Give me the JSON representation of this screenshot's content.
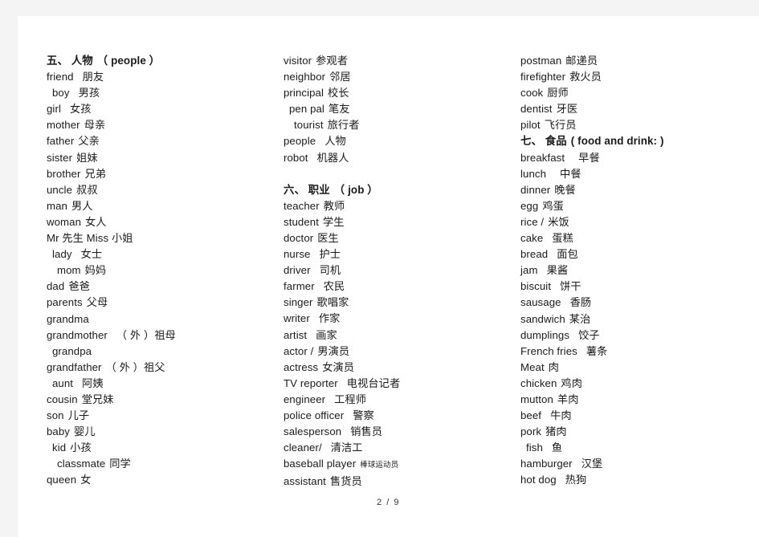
{
  "document": {
    "page_label": "2 / 9",
    "background_color": "#f4f4f4",
    "page_color": "#ffffff",
    "text_color": "#1a1a1a"
  },
  "columns": [
    {
      "id": "column-1",
      "entries": [
        {
          "en": "五、 人物",
          "cn": "（ people ）",
          "heading": true,
          "raw": "五、 人物（people）"
        },
        {
          "en": "friend",
          "cn": "朋友",
          "gap": "wide"
        },
        {
          "en": "boy",
          "cn": "男孩",
          "indent": 1,
          "gap": "wide"
        },
        {
          "en": "girl",
          "cn": "女孩",
          "gap": "wide"
        },
        {
          "en": "mother",
          "cn": "母亲",
          "gap": "normal"
        },
        {
          "en": "father",
          "cn": "父亲",
          "gap": "normal"
        },
        {
          "en": "sister",
          "cn": "姐妹",
          "gap": "normal"
        },
        {
          "en": "brother",
          "cn": "兄弟",
          "gap": "normal"
        },
        {
          "en": "uncle",
          "cn": "叔叔",
          "gap": "normal"
        },
        {
          "en": "man",
          "cn": "男人",
          "gap": "normal"
        },
        {
          "en": "woman",
          "cn": "女人",
          "gap": "normal"
        },
        {
          "en": "Mr 先生   Miss 小姐",
          "cn": "",
          "gap": "none"
        },
        {
          "en": "lady",
          "cn": "女士",
          "indent": 1,
          "gap": "wide"
        },
        {
          "en": "mom",
          "cn": "妈妈",
          "indent": 2,
          "gap": "normal"
        },
        {
          "en": "dad",
          "cn": "爸爸",
          "gap": "normal"
        },
        {
          "en": "parents",
          "cn": "父母",
          "gap": "normal"
        },
        {
          "en": "grandma",
          "cn": "",
          "gap": "none"
        },
        {
          "en": "grandmother",
          "cn": "（ 外 ）祖母",
          "gap": "wide"
        },
        {
          "en": "grandpa",
          "cn": "",
          "indent": 1,
          "gap": "none"
        },
        {
          "en": "grandfather",
          "cn": "（ 外 ）祖父",
          "gap": "normal"
        },
        {
          "en": "aunt",
          "cn": "阿姨",
          "indent": 1,
          "gap": "wide"
        },
        {
          "en": "cousin",
          "cn": "堂兄妹",
          "gap": "normal"
        },
        {
          "en": "son",
          "cn": "儿子",
          "gap": "normal"
        },
        {
          "en": "baby",
          "cn": "婴儿",
          "gap": "normal"
        },
        {
          "en": "kid",
          "cn": "小孩",
          "indent": 1,
          "gap": "normal"
        },
        {
          "en": "classmate",
          "cn": "同学",
          "indent": 2,
          "gap": "normal"
        },
        {
          "en": "queen",
          "cn": "女",
          "gap": "normal"
        }
      ]
    },
    {
      "id": "column-2",
      "entries": [
        {
          "en": "visitor",
          "cn": "参观者",
          "gap": "normal"
        },
        {
          "en": "neighbor",
          "cn": "邻居",
          "gap": "normal"
        },
        {
          "en": "principal",
          "cn": "校长",
          "gap": "normal"
        },
        {
          "en": "pen pal",
          "cn": "笔友",
          "indent": 1,
          "gap": "normal"
        },
        {
          "en": "tourist",
          "cn": "旅行者",
          "indent": 2,
          "gap": "normal"
        },
        {
          "en": "people",
          "cn": "人物",
          "gap": "wide"
        },
        {
          "en": "robot",
          "cn": "机器人",
          "gap": "wide"
        },
        {
          "en": "六、 职业",
          "cn": "（ job ）",
          "heading": true,
          "spacer": true,
          "raw": "六、 职业（job）"
        },
        {
          "en": "teacher",
          "cn": "教师",
          "gap": "normal"
        },
        {
          "en": "student",
          "cn": "学生",
          "gap": "normal"
        },
        {
          "en": "doctor",
          "cn": "医生",
          "gap": "normal"
        },
        {
          "en": "nurse",
          "cn": "护士",
          "gap": "wide"
        },
        {
          "en": "driver",
          "cn": "司机",
          "gap": "wide"
        },
        {
          "en": "farmer",
          "cn": "农民",
          "gap": "wide"
        },
        {
          "en": "singer",
          "cn": "歌唱家",
          "gap": "normal"
        },
        {
          "en": "writer",
          "cn": "作家",
          "gap": "wide"
        },
        {
          "en": "artist",
          "cn": "画家",
          "gap": "wide"
        },
        {
          "en": "actor /",
          "cn": "男演员",
          "gap": "none"
        },
        {
          "en": "actress",
          "cn": "女演员",
          "gap": "normal"
        },
        {
          "en": "TV reporter",
          "cn": "电视台记者",
          "gap": "wide"
        },
        {
          "en": "engineer",
          "cn": "工程师",
          "gap": "wide"
        },
        {
          "en": "police officer",
          "cn": "警察",
          "gap": "wide"
        },
        {
          "en": "salesperson",
          "cn": "销售员",
          "gap": "wide"
        },
        {
          "en": "cleaner/",
          "cn": "清洁工",
          "gap": "wide"
        },
        {
          "en": "baseball player",
          "cn": "棒球运动员",
          "cn_small": true,
          "gap": "normal"
        },
        {
          "en": "assistant",
          "cn": "售货员",
          "gap": "normal"
        }
      ]
    },
    {
      "id": "column-3",
      "entries": [
        {
          "en": "postman",
          "cn": "邮递员",
          "gap": "normal"
        },
        {
          "en": "firefighter",
          "cn": "救火员",
          "gap": "normal"
        },
        {
          "en": "cook",
          "cn": "厨师",
          "gap": "normal"
        },
        {
          "en": "dentist",
          "cn": "牙医",
          "gap": "normal"
        },
        {
          "en": "pilot",
          "cn": "飞行员",
          "gap": "normal"
        },
        {
          "en": "七、 食品",
          "cn": "( food and drink: )",
          "heading": true,
          "raw": "七、 食品 ( food and drink: )"
        },
        {
          "en": "breakfast",
          "cn": "早餐",
          "gap": "xwide"
        },
        {
          "en": "lunch",
          "cn": "中餐",
          "gap": "xwide"
        },
        {
          "en": "dinner",
          "cn": "晚餐",
          "gap": "normal"
        },
        {
          "en": "egg",
          "cn": "鸡蛋",
          "gap": "normal"
        },
        {
          "en": "rice /",
          "cn": "米饭",
          "gap": "normal"
        },
        {
          "en": "cake",
          "cn": "蛋糕",
          "gap": "wide"
        },
        {
          "en": "bread",
          "cn": "面包",
          "gap": "wide"
        },
        {
          "en": "jam",
          "cn": "果酱",
          "gap": "wide"
        },
        {
          "en": "biscuit",
          "cn": "饼干",
          "gap": "wide"
        },
        {
          "en": "sausage",
          "cn": "香肠",
          "gap": "wide"
        },
        {
          "en": "sandwich",
          "cn": "某治",
          "gap": "normal"
        },
        {
          "en": "dumplings",
          "cn": "饺子",
          "gap": "wide"
        },
        {
          "en": "French fries",
          "cn": "薯条",
          "gap": "wide"
        },
        {
          "en": "Meat",
          "cn": "肉",
          "gap": "normal"
        },
        {
          "en": "chicken",
          "cn": "鸡肉",
          "gap": "normal"
        },
        {
          "en": "mutton",
          "cn": "羊肉",
          "gap": "normal"
        },
        {
          "en": "beef",
          "cn": "牛肉",
          "gap": "wide"
        },
        {
          "en": "pork",
          "cn": "猪肉",
          "gap": "normal"
        },
        {
          "en": "fish",
          "cn": "鱼",
          "indent": 1,
          "gap": "wide"
        },
        {
          "en": "hamburger",
          "cn": "汉堡",
          "gap": "wide"
        },
        {
          "en": "hot dog",
          "cn": "热狗",
          "gap": "wide"
        }
      ]
    }
  ]
}
